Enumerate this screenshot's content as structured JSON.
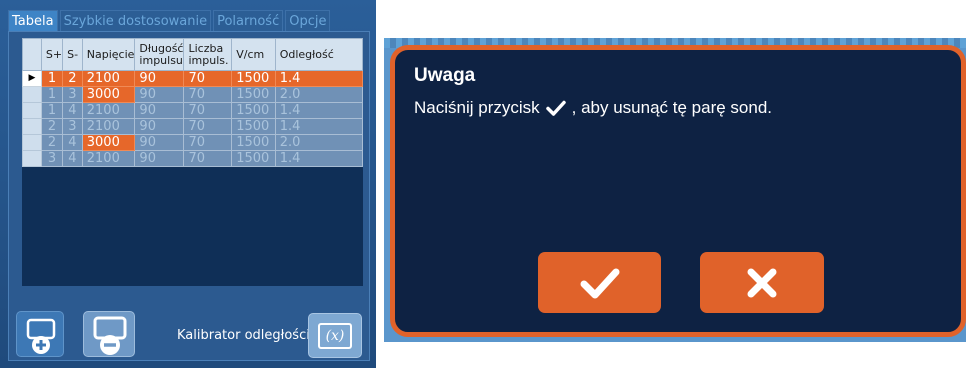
{
  "tabs": [
    "Tabela",
    "Szybkie dostosowanie",
    "Polarność",
    "Opcje"
  ],
  "table": {
    "headers": [
      "",
      "S+",
      "S-",
      "Napięcie",
      "Długość impulsu",
      "Liczba impuls.",
      "V/cm",
      "Odległość"
    ],
    "rows": [
      {
        "marker": "▶",
        "s_plus": "1",
        "s_minus": "2",
        "voltage": "2100",
        "pulse_length": "90",
        "pulse_count": "70",
        "v_cm": "1500",
        "distance": "1.4"
      },
      {
        "marker": "",
        "s_plus": "1",
        "s_minus": "3",
        "voltage": "3000",
        "pulse_length": "90",
        "pulse_count": "70",
        "v_cm": "1500",
        "distance": "2.0"
      },
      {
        "marker": "",
        "s_plus": "1",
        "s_minus": "4",
        "voltage": "2100",
        "pulse_length": "90",
        "pulse_count": "70",
        "v_cm": "1500",
        "distance": "1.4"
      },
      {
        "marker": "",
        "s_plus": "2",
        "s_minus": "3",
        "voltage": "2100",
        "pulse_length": "90",
        "pulse_count": "70",
        "v_cm": "1500",
        "distance": "1.4"
      },
      {
        "marker": "",
        "s_plus": "2",
        "s_minus": "4",
        "voltage": "3000",
        "pulse_length": "90",
        "pulse_count": "70",
        "v_cm": "1500",
        "distance": "2.0"
      },
      {
        "marker": "",
        "s_plus": "3",
        "s_minus": "4",
        "voltage": "2100",
        "pulse_length": "90",
        "pulse_count": "70",
        "v_cm": "1500",
        "distance": "1.4"
      }
    ]
  },
  "footer": {
    "calibrator_label": "Kalibrator odległości",
    "calc_icon_text": "(x)"
  },
  "dialog": {
    "title": "Uwaga",
    "message_before": "Naciśnij przycisk",
    "message_after": ", aby usunąć tę parę sond."
  },
  "icons": {
    "add": "add-probe-icon",
    "remove": "remove-probe-icon",
    "calculator": "calculator-icon",
    "confirm": "checkmark-icon",
    "cancel": "close-icon"
  },
  "colors": {
    "accent": "#e0622a",
    "panel": "#1f4a7c",
    "dialog_bg": "#0e2243"
  }
}
